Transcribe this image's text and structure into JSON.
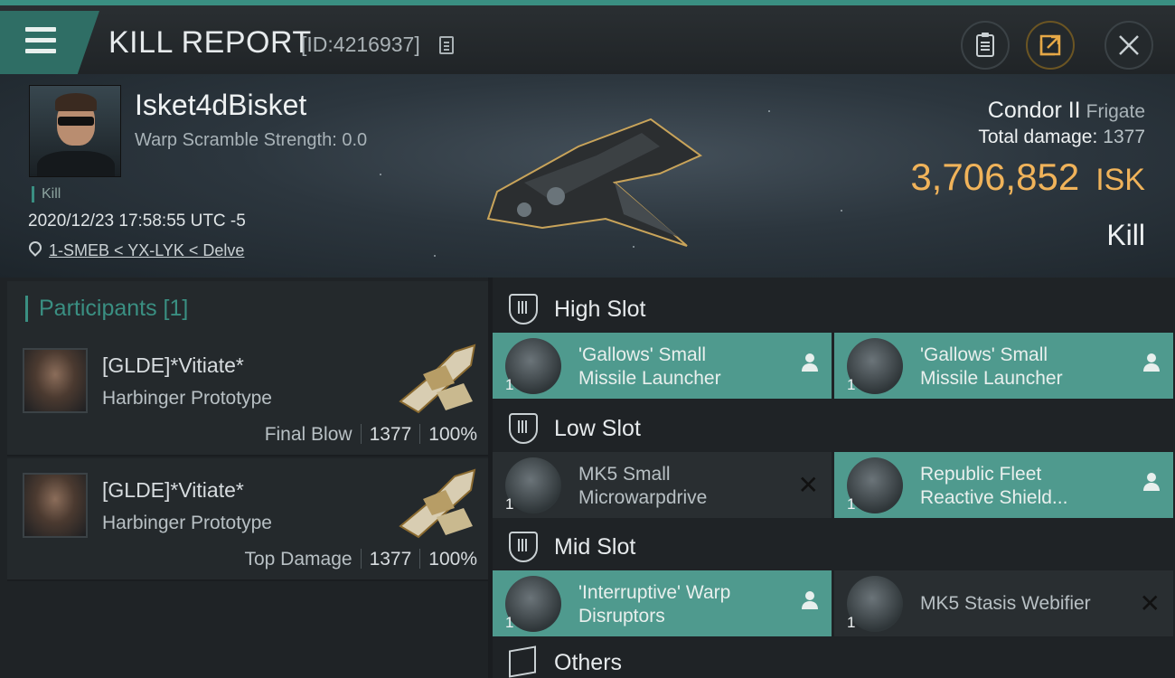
{
  "header": {
    "title": "KILL REPORT",
    "report_id": "[ID:4216937]"
  },
  "victim": {
    "name": "Isket4dBisket",
    "warp_scramble": "Warp Scramble Strength: 0.0",
    "tag": "Kill",
    "timestamp": "2020/12/23 17:58:55 UTC -5",
    "location": "1-SMEB < YX-LYK < Delve"
  },
  "ship": {
    "name": "Condor II",
    "class": "Frigate",
    "total_damage_label": "Total damage:",
    "total_damage": "1377",
    "value": "3,706,852",
    "currency": "ISK",
    "result": "Kill"
  },
  "participants": {
    "header": "Participants [1]",
    "rows": [
      {
        "name": "[GLDE]*Vitiate*",
        "ship": "Harbinger Prototype",
        "label": "Final Blow",
        "damage": "1377",
        "percent": "100%"
      },
      {
        "name": "[GLDE]*Vitiate*",
        "ship": "Harbinger Prototype",
        "label": "Top Damage",
        "damage": "1377",
        "percent": "100%"
      }
    ]
  },
  "slots": {
    "high": {
      "title": "High Slot",
      "items": [
        {
          "line1": "'Gallows' Small",
          "line2": "Missile Launcher",
          "qty": "1",
          "state": "person-icon"
        },
        {
          "line1": "'Gallows' Small",
          "line2": "Missile Launcher",
          "qty": "1",
          "state": "person-icon"
        }
      ]
    },
    "low": {
      "title": "Low Slot",
      "items": [
        {
          "line1": "MK5 Small",
          "line2": "Microwarpdrive",
          "qty": "1",
          "state": "x-icon"
        },
        {
          "line1": "Republic Fleet",
          "line2": "Reactive Shield...",
          "qty": "1",
          "state": "person-icon"
        }
      ]
    },
    "mid": {
      "title": "Mid Slot",
      "items": [
        {
          "line1": "'Interruptive' Warp",
          "line2": "Disruptors",
          "qty": "1",
          "state": "person-icon"
        },
        {
          "line1": "MK5 Stasis Webifier",
          "line2": "",
          "qty": "1",
          "state": "x-icon"
        }
      ]
    },
    "others": {
      "title": "Others"
    }
  },
  "colors": {
    "accent": "#3a8f82",
    "dropped": "#4f9a8e",
    "isk": "#f0b35a"
  }
}
